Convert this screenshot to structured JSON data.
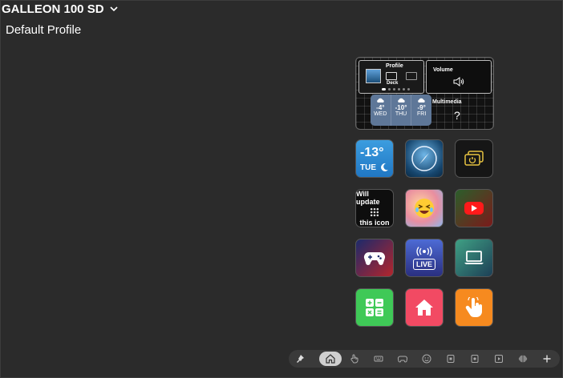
{
  "header": {
    "device_name": "GALLEON 100 SD",
    "profile_name": "Default Profile"
  },
  "panel": {
    "profile_widget": {
      "label": "Profile",
      "sub_label": "Deck",
      "icon": "keyboard-icon"
    },
    "volume_widget": {
      "label": "Volume",
      "icon": "speaker-icon"
    },
    "weather_widget": {
      "days": [
        {
          "temp": "-4°",
          "day": "WED"
        },
        {
          "temp": "-10°",
          "day": "THU"
        },
        {
          "temp": "-9°",
          "day": "FRI"
        }
      ]
    },
    "media_widget": {
      "label": "Multimedia",
      "glyph": "?"
    }
  },
  "keys": {
    "weather": {
      "temp": "-13°",
      "day": "TUE"
    },
    "update": {
      "line1": "Will update",
      "line2": "this icon"
    },
    "live": {
      "label": "LIVE"
    }
  },
  "toolbar": {
    "active": "home",
    "items": [
      "pin-icon",
      "home-icon",
      "hand-icon",
      "keyboard-icon",
      "gamepad-icon",
      "emoji-icon",
      "widget-icon",
      "media-icon",
      "play-icon",
      "brain-icon",
      "plus-icon"
    ]
  },
  "colors": {
    "background": "#2b2b2b",
    "toolbar": "#3a3a3a",
    "calc_key": "#3fc957",
    "home_key": "#f24a63",
    "touch_key": "#f68a1f",
    "weather_widget": "#5e7798"
  }
}
